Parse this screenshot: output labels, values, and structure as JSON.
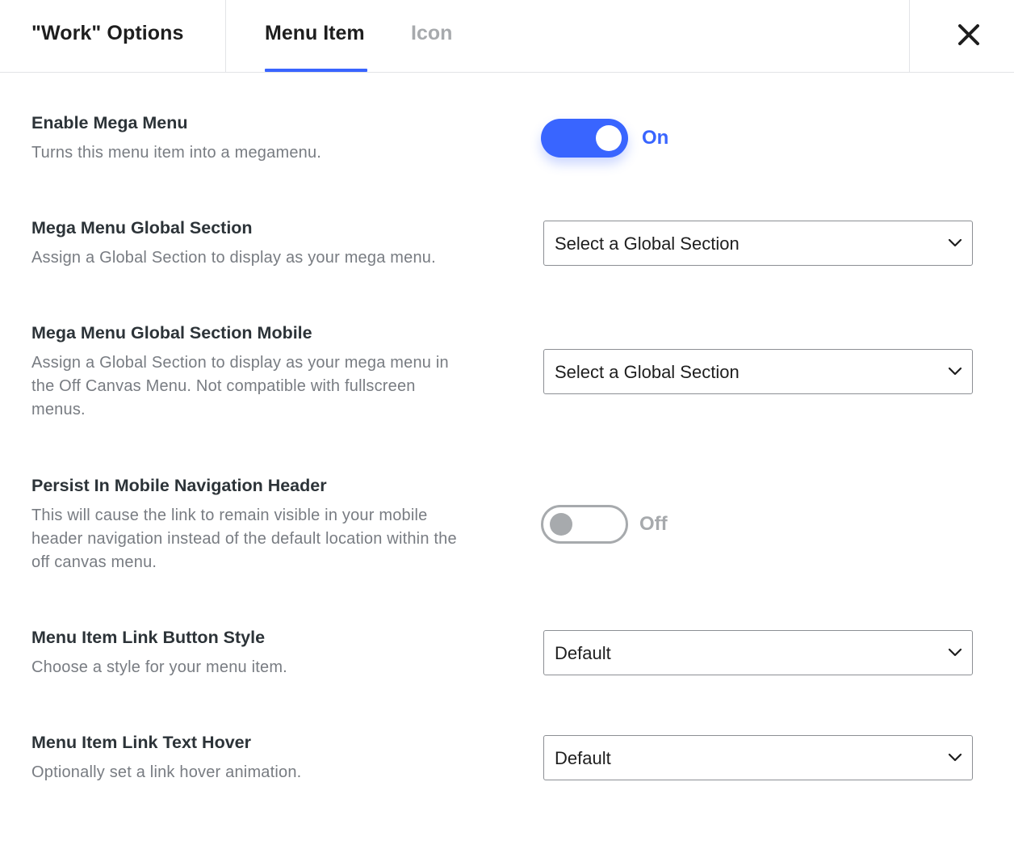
{
  "header": {
    "title": "\"Work\" Options",
    "tabs": [
      {
        "label": "Menu Item",
        "active": true
      },
      {
        "label": "Icon",
        "active": false
      }
    ],
    "close_icon": "close-icon"
  },
  "colors": {
    "accent": "#3965ff",
    "muted": "#a7aaad",
    "text": "#2c3338",
    "description": "#787c82"
  },
  "settings": {
    "enable_mega_menu": {
      "title": "Enable Mega Menu",
      "description": "Turns this menu item into a megamenu.",
      "state_label": "On",
      "enabled": true
    },
    "mega_menu_global_section": {
      "title": "Mega Menu Global Section",
      "description": "Assign a Global Section to display as your mega menu.",
      "value": "Select a Global Section"
    },
    "mega_menu_global_section_mobile": {
      "title": "Mega Menu Global Section Mobile",
      "description": "Assign a Global Section to display as your mega menu in the Off Canvas Menu. Not compatible with fullscreen menus.",
      "value": "Select a Global Section"
    },
    "persist_mobile_nav_header": {
      "title": "Persist In Mobile Navigation Header",
      "description": "This will cause the link to remain visible in your mobile header navigation instead of the default location within the off canvas menu.",
      "state_label": "Off",
      "enabled": false
    },
    "menu_item_link_button_style": {
      "title": "Menu Item Link Button Style",
      "description": "Choose a style for your menu item.",
      "value": "Default"
    },
    "menu_item_link_text_hover": {
      "title": "Menu Item Link Text Hover",
      "description": "Optionally set a link hover animation.",
      "value": "Default"
    }
  }
}
